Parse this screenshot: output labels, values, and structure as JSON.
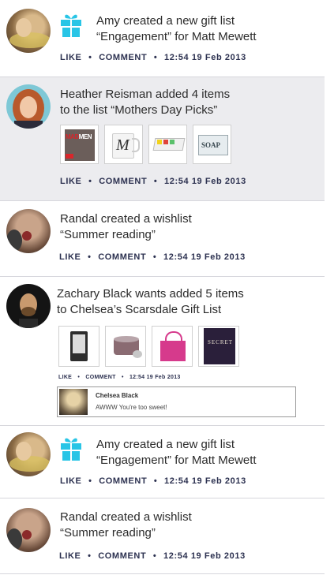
{
  "feed": [
    {
      "text_line1": "Amy created a new gift list",
      "text_line2": "“Engagement” for Matt Mewett",
      "like": "LIKE",
      "comment": "COMMENT",
      "timestamp": "12:54 19 Feb 2013"
    },
    {
      "text_line1": "Heather Reisman added 4 items",
      "text_line2": "to the list “Mothers Day Picks”",
      "like": "LIKE",
      "comment": "COMMENT",
      "timestamp": "12:54 19 Feb 2013",
      "items": [
        {
          "name": "mad-men-product",
          "caption": "MADMEN"
        },
        {
          "name": "monogram-mug-product",
          "caption": "M"
        },
        {
          "name": "tray-product"
        },
        {
          "name": "soap-product",
          "caption": "SOAP"
        }
      ]
    },
    {
      "text_line1": "Randal created a wishlist",
      "text_line2": "“Summer reading”",
      "like": "LIKE",
      "comment": "COMMENT",
      "timestamp": "12:54 19 Feb 2013"
    },
    {
      "text_line1": "Zachary Black wants added 5 items",
      "text_line2": "to Chelsea’s Scarsdale Gift List",
      "like": "LIKE",
      "comment": "COMMENT",
      "timestamp": "12:54 19 Feb 2013",
      "items": [
        {
          "name": "ereader-product"
        },
        {
          "name": "candle-product"
        },
        {
          "name": "pink-tote-product"
        },
        {
          "name": "secret-book-product",
          "caption": "SECRET"
        }
      ],
      "reply": {
        "name": "Chelsea Black",
        "text": "AWWW You're too sweet!"
      }
    },
    {
      "text_line1": "Amy created a new gift list",
      "text_line2": "“Engagement” for Matt Mewett",
      "like": "LIKE",
      "comment": "COMMENT",
      "timestamp": "12:54 19 Feb 2013"
    },
    {
      "text_line1": "Randal created a wishlist",
      "text_line2": "“Summer reading”",
      "like": "LIKE",
      "comment": "COMMENT",
      "timestamp": "12:54 19 Feb 2013"
    }
  ],
  "separator": "•",
  "colors": {
    "gift_icon": "#29c5e6",
    "action_text": "#2c3150",
    "highlight_bg": "#ececef",
    "divider": "#d6d6dc"
  },
  "icons": {
    "gift": "gift-icon"
  }
}
